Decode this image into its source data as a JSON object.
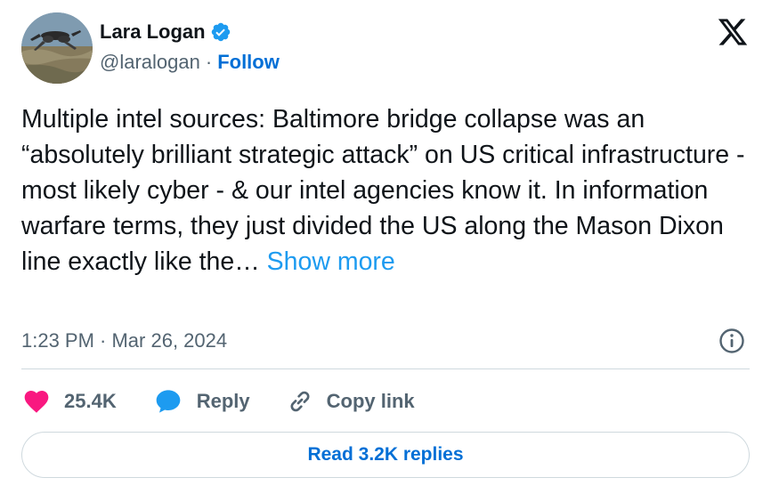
{
  "author": {
    "name": "Lara Logan",
    "handle": "@laralogan",
    "separator": "·",
    "follow_label": "Follow"
  },
  "tweet": {
    "text": "Multiple intel sources: Baltimore bridge collapse was an “absolutely brilliant strategic attack” on US critical infrastructure - most likely cyber - & our intel agencies know it. In information warfare terms, they just divided the US along the Mason Dixon line exactly like the…",
    "show_more_label": "Show more",
    "timestamp": "1:23 PM · Mar 26, 2024"
  },
  "actions": {
    "likes": "25.4K",
    "reply_label": "Reply",
    "copy_link_label": "Copy link"
  },
  "read_replies_label": "Read 3.2K replies",
  "colors": {
    "link": "#006fd6",
    "show_more": "#1d9bf0",
    "like": "#f91880",
    "verified": "#1d9bf0",
    "secondary_text": "#536471"
  },
  "icons": [
    "verified-badge-icon",
    "x-logo-icon",
    "info-icon",
    "heart-icon",
    "reply-bubble-icon",
    "link-icon"
  ]
}
